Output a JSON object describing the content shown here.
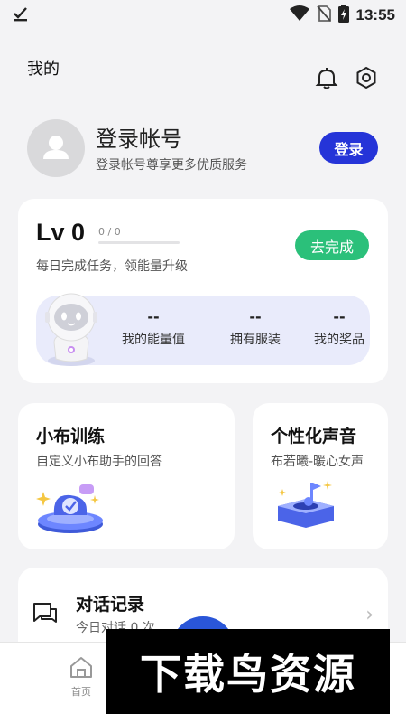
{
  "status_bar": {
    "time": "13:55"
  },
  "header": {
    "title": "我的"
  },
  "profile": {
    "title": "登录帐号",
    "subtitle": "登录帐号尊享更多优质服务",
    "login_button": "登录"
  },
  "level": {
    "title": "Lv 0",
    "progress_text": "0 / 0",
    "progress": 0,
    "desc": "每日完成任务，领能量升级",
    "action_button": "去完成",
    "stats": [
      {
        "value": "--",
        "label": "我的能量值"
      },
      {
        "value": "--",
        "label": "拥有服装"
      },
      {
        "value": "--",
        "label": "我的奖品"
      }
    ]
  },
  "features": [
    {
      "title": "小布训练",
      "subtitle": "自定义小布助手的回答"
    },
    {
      "title": "个性化声音",
      "subtitle": "布若曦-暖心女声"
    }
  ],
  "chat": {
    "title": "对话记录",
    "subtitle": "今日对话 0 次"
  },
  "nav": {
    "home_label": "首页"
  },
  "watermark": {
    "text": "下载鸟资源"
  },
  "colors": {
    "accent": "#2534d8",
    "success": "#2bc07a",
    "background": "#f3f3f5",
    "stats_bg": "#e9ebfb"
  }
}
